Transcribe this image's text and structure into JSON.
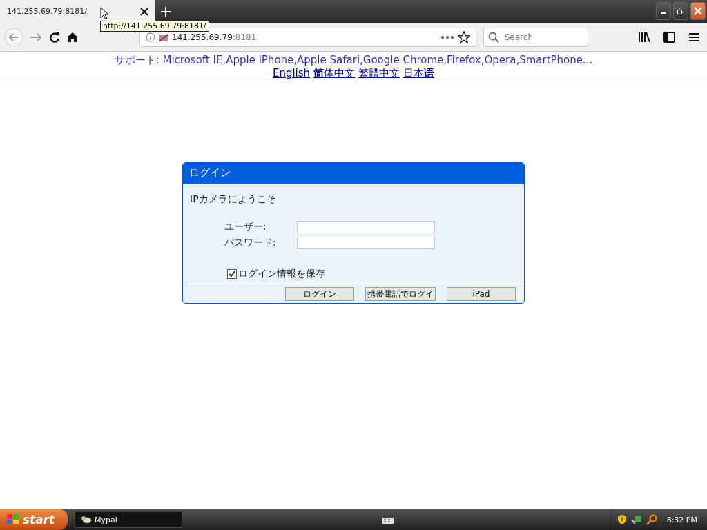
{
  "browser": {
    "tab_title": "141.255.69.79:8181/",
    "tooltip": "http://141.255.69.79:8181/",
    "url_host": "141.255.69.79",
    "url_port": ":8181",
    "search_placeholder": "Search"
  },
  "page": {
    "support": "サポート: Microsoft IE,Apple iPhone,Apple Safari,Google Chrome,Firefox,Opera,SmartPhone...",
    "languages": [
      "English",
      "**简**体中文",
      "繁體中文",
      "日本**语**"
    ]
  },
  "login": {
    "title": "ログイン",
    "welcome": "IPカメラにようこそ",
    "fields": [
      {
        "label": "ユーザー:"
      },
      {
        "label": "パスワード:"
      }
    ],
    "remember": {
      "label": "ログイン情報を保存",
      "checked": true
    },
    "buttons": [
      "ログイン",
      "携帯電話でログイ",
      "iPad"
    ]
  },
  "taskbar": {
    "start": "start",
    "task": "Mypal",
    "clock": "8:32 PM"
  }
}
